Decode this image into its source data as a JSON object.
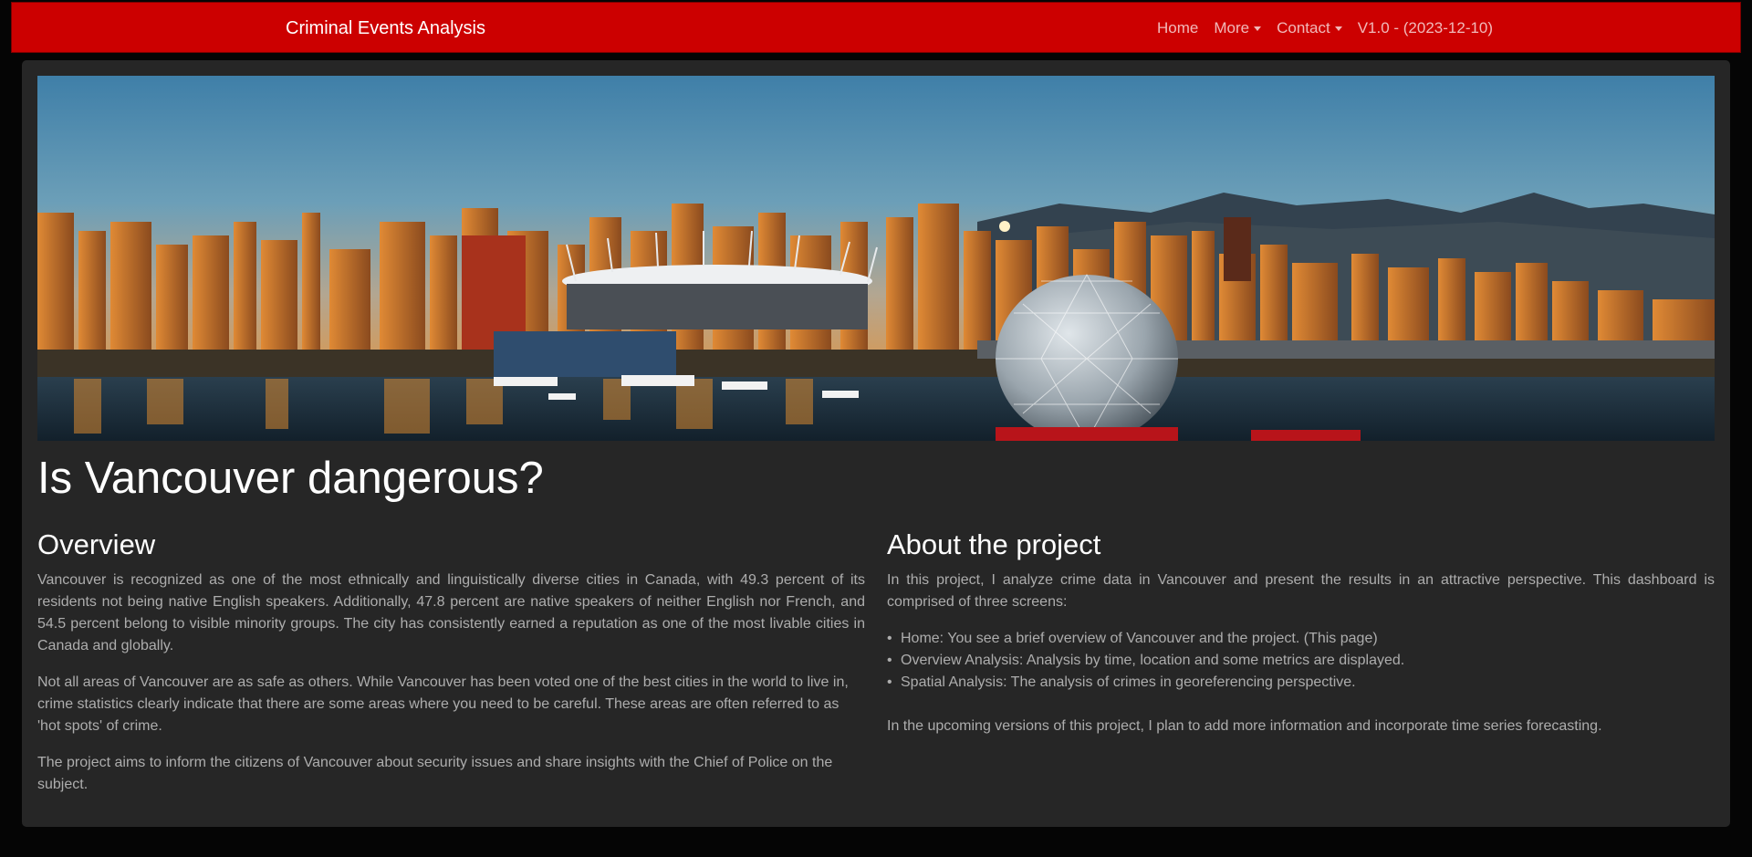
{
  "navbar": {
    "brand": "Criminal Events Analysis",
    "links": [
      {
        "label": "Home",
        "dropdown": false
      },
      {
        "label": "More",
        "dropdown": true
      },
      {
        "label": "Contact",
        "dropdown": true
      },
      {
        "label": "V1.0 - (2023-12-10)",
        "dropdown": false
      }
    ],
    "bg_color": "#cc0000"
  },
  "main": {
    "title": "Is Vancouver dangerous?",
    "overview": {
      "heading": "Overview",
      "paragraphs": [
        "Vancouver is recognized as one of the most ethnically and linguistically diverse cities in Canada, with 49.3 percent of its residents not being native English speakers. Additionally, 47.8 percent are native speakers of neither English nor French, and 54.5 percent belong to visible minority groups. The city has consistently earned a reputation as one of the most livable cities in Canada and globally.",
        "Not all areas of Vancouver are as safe as others. While Vancouver has been voted one of the best cities in the world to live in, crime statistics clearly indicate that there are some areas where you need to be careful. These areas are often referred to as 'hot spots' of crime.",
        "The project aims to inform the citizens of Vancouver about security issues and share insights with the Chief of Police on the subject."
      ]
    },
    "about": {
      "heading": "About the project",
      "intro": "In this project, I analyze crime data in Vancouver and present the results in an attractive perspective. This dashboard is comprised of three screens:",
      "items": [
        "Home: You see a brief overview of Vancouver and the project. (This page)",
        "Overview Analysis: Analysis by time, location and some metrics are displayed.",
        "Spatial Analysis: The analysis of crimes in georeferencing perspective."
      ],
      "outro": "In the upcoming versions of this project, I plan to add more information and incorporate time series forecasting."
    }
  }
}
